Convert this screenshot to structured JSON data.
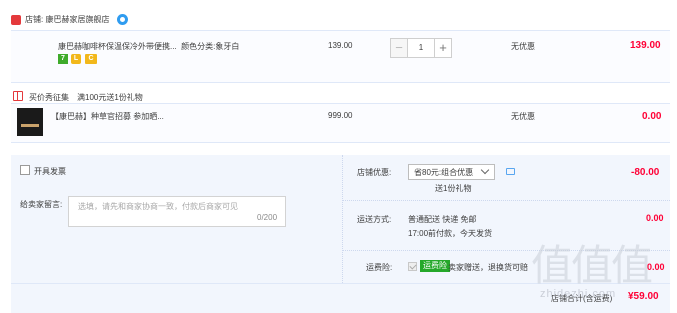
{
  "shop": {
    "label": "店铺: ",
    "name": "康巴赫家居旗舰店",
    "icon": "shop-icon",
    "chat_icon": "wangwang-chat-icon"
  },
  "item1": {
    "title": "康巴赫咖啡杯保温保冷外带便携...",
    "spec": "颜色分类:象牙白",
    "badges": [
      "7",
      "L",
      "C"
    ],
    "price": "139.00",
    "quantity": "1",
    "minus": "−",
    "plus": "+",
    "promo": "无优惠",
    "subtotal": "139.00"
  },
  "gift_section": {
    "label": "买价秀征集",
    "sub": "满100元送1份礼物"
  },
  "item2": {
    "title": "【康巴赫】种草官招募 参加晒...",
    "price": "999.00",
    "promo": "无优惠",
    "subtotal": "0.00"
  },
  "invoice": {
    "label": "开具发票"
  },
  "message": {
    "label": "给卖家留言:",
    "placeholder": "选填，请先和商家协商一致，付款后商家可见",
    "count": "0/200"
  },
  "coupon": {
    "label": "店铺优惠:",
    "selected": "省80元:组合优惠",
    "gift": "送1份礼物",
    "discount": "-80.00"
  },
  "shipping": {
    "label": "运送方式:",
    "line1": "普通配送 快递 免邮",
    "line2": "17:00前付款，今天发货",
    "cost": "0.00"
  },
  "insurance": {
    "label": "运费险:",
    "badge": "运费险",
    "text": "卖家赠送，退换货可赔",
    "cost": "0.00"
  },
  "total": {
    "label": "店铺合计(含运费)",
    "value": "¥59.00"
  },
  "watermark": {
    "text": "值值值",
    "sub": "zhidezhi.com"
  },
  "colors": {
    "accent_red": "#ff0036",
    "panel_bg": "#f2f6fd",
    "insurance_green": "#25a82a"
  }
}
